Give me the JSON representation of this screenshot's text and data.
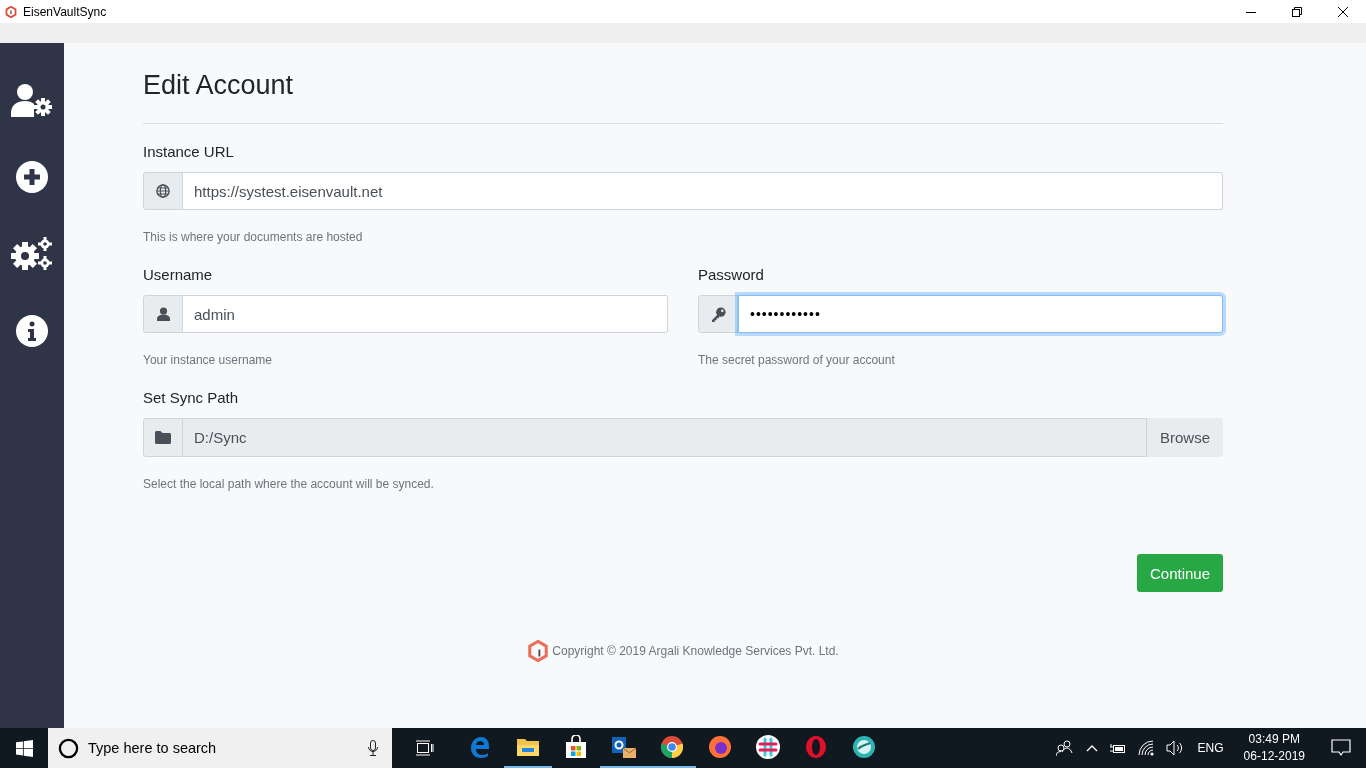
{
  "window": {
    "title": "EisenVaultSync"
  },
  "page": {
    "title": "Edit Account"
  },
  "instance_url": {
    "label": "Instance URL",
    "value": "https://systest.eisenvault.net",
    "help": "This is where your documents are hosted",
    "focused": false
  },
  "username": {
    "label": "Username",
    "value": "admin",
    "help": "Your instance username",
    "focused": false
  },
  "password": {
    "label": "Password",
    "value": "••••••••••••",
    "help": "The secret password of your account",
    "focused": true
  },
  "sync_path": {
    "label": "Set Sync Path",
    "value": "D:/Sync",
    "disabled": true,
    "button": "Browse",
    "help": "Select the local path where the account will be synced."
  },
  "continue_button": "Continue",
  "footer": {
    "copyright": "Copyright © 2019 Argali Knowledge Services Pvt. Ltd."
  },
  "taskbar": {
    "search_placeholder": "Type here to search",
    "apps": [
      {
        "kind": "edge",
        "running": false
      },
      {
        "kind": "explorer",
        "running": true
      },
      {
        "kind": "store",
        "running": false
      },
      {
        "kind": "outlook",
        "running": true
      },
      {
        "kind": "chrome",
        "running": true
      },
      {
        "kind": "firefox",
        "running": false
      },
      {
        "kind": "slack",
        "running": false
      },
      {
        "kind": "opera",
        "running": false
      },
      {
        "kind": "globe",
        "running": false
      }
    ],
    "language": "ENG",
    "time": "03:49 PM",
    "date": "06-12-2019"
  }
}
